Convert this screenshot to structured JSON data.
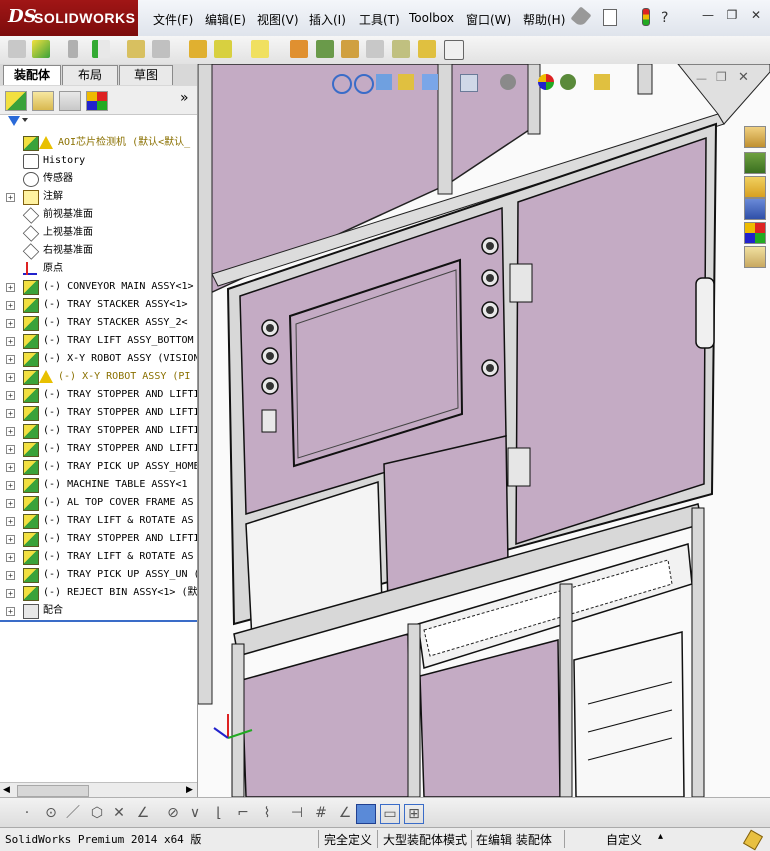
{
  "app": {
    "logo_mark": "DS",
    "logo_text": "SOLIDWORKS",
    "menus": [
      "文件(F)",
      "编辑(E)",
      "视图(V)",
      "插入(I)",
      "工具(T)",
      "Toolbox",
      "窗口(W)",
      "帮助(H)"
    ],
    "window_controls": {
      "minimize": "—",
      "restore": "❐",
      "close": "✕"
    }
  },
  "panel": {
    "tabs": [
      "装配体",
      "布局",
      "草图"
    ],
    "active_tab": "装配体",
    "expand_symbol": "»",
    "tree": [
      {
        "label": "AOI芯片检测机  (默认<默认_",
        "icon": "assembly-icon",
        "warning": true,
        "expand": ""
      },
      {
        "label": "History",
        "icon": "history-icon",
        "warning": false,
        "expand": ""
      },
      {
        "label": "传感器",
        "icon": "sensor-icon",
        "warning": false,
        "expand": ""
      },
      {
        "label": "注解",
        "icon": "annotation-icon",
        "warning": false,
        "expand": "+"
      },
      {
        "label": "前视基准面",
        "icon": "plane-icon",
        "warning": false,
        "expand": ""
      },
      {
        "label": "上视基准面",
        "icon": "plane-icon",
        "warning": false,
        "expand": ""
      },
      {
        "label": "右视基准面",
        "icon": "plane-icon",
        "warning": false,
        "expand": ""
      },
      {
        "label": "原点",
        "icon": "origin-icon",
        "warning": false,
        "expand": ""
      },
      {
        "label": "(-) CONVEYOR MAIN ASSY<1>",
        "icon": "assembly-icon",
        "warning": false,
        "expand": "+"
      },
      {
        "label": "(-) TRAY STACKER  ASSY<1>",
        "icon": "assembly-icon",
        "warning": false,
        "expand": "+"
      },
      {
        "label": "(-) TRAY STACKER  ASSY_2<",
        "icon": "assembly-icon",
        "warning": false,
        "expand": "+"
      },
      {
        "label": "(-) TRAY LIFT ASSY_BOTTOM",
        "icon": "assembly-icon",
        "warning": false,
        "expand": "+"
      },
      {
        "label": "(-) X-Y ROBOT ASSY (VISION",
        "icon": "assembly-icon",
        "warning": false,
        "expand": "+"
      },
      {
        "label": "(-) X-Y ROBOT  ASSY  (PI",
        "icon": "assembly-icon",
        "warning": true,
        "expand": "+"
      },
      {
        "label": "(-) TRAY STOPPER AND LIFTI",
        "icon": "assembly-icon",
        "warning": false,
        "expand": "+"
      },
      {
        "label": "(-) TRAY STOPPER AND LIFTI",
        "icon": "assembly-icon",
        "warning": false,
        "expand": "+"
      },
      {
        "label": "(-) TRAY STOPPER AND LIFTI",
        "icon": "assembly-icon",
        "warning": false,
        "expand": "+"
      },
      {
        "label": "(-) TRAY STOPPER AND LIFTI",
        "icon": "assembly-icon",
        "warning": false,
        "expand": "+"
      },
      {
        "label": "(-) TRAY PICK UP ASSY_HOME",
        "icon": "assembly-icon",
        "warning": false,
        "expand": "+"
      },
      {
        "label": "(-) MACHINE TABLE  ASSY<1",
        "icon": "assembly-icon",
        "warning": false,
        "expand": "+"
      },
      {
        "label": "(-) AL TOP COVER FRAME  AS",
        "icon": "assembly-icon",
        "warning": false,
        "expand": "+"
      },
      {
        "label": "(-) TRAY LIFT & ROTATE  AS",
        "icon": "assembly-icon",
        "warning": false,
        "expand": "+"
      },
      {
        "label": "(-) TRAY STOPPER AND LIFTI",
        "icon": "assembly-icon",
        "warning": false,
        "expand": "+"
      },
      {
        "label": "(-) TRAY LIFT & ROTATE  AS",
        "icon": "assembly-icon",
        "warning": false,
        "expand": "+"
      },
      {
        "label": "(-) TRAY PICK UP ASSY_UN (",
        "icon": "assembly-icon",
        "warning": false,
        "expand": "+"
      },
      {
        "label": "(-) REJECT BIN ASSY<1> (默",
        "icon": "assembly-icon",
        "warning": false,
        "expand": "+"
      },
      {
        "label": "配合",
        "icon": "mates-icon",
        "warning": false,
        "expand": "+"
      }
    ]
  },
  "status": {
    "product": "SolidWorks Premium 2014 x64 版",
    "fully_defined": "完全定义",
    "large_assembly": "大型装配体模式",
    "editing": "在编辑 装配体",
    "units": "自定义",
    "caret": "▴"
  },
  "colors": {
    "cabinet_panel": "#c4abc4",
    "frame": "#d8d8d8",
    "outline": "#1a1a1a",
    "logo_red": "#8e1111"
  }
}
